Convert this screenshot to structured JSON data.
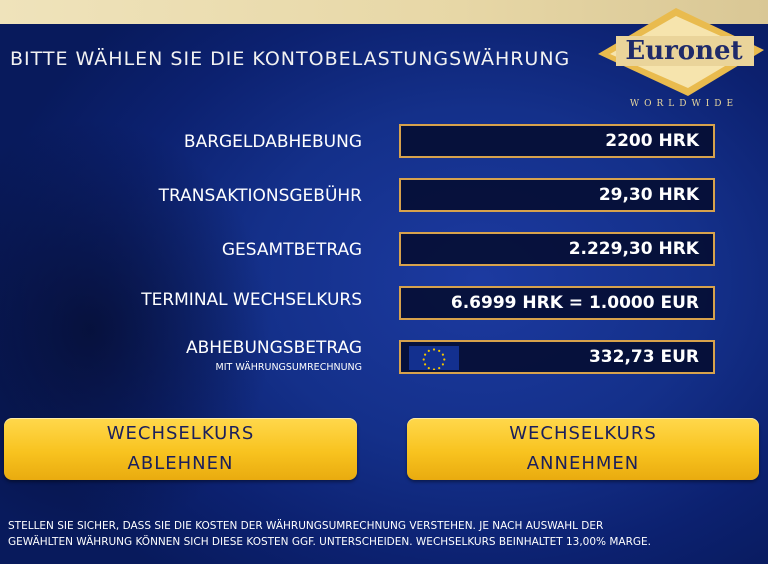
{
  "screen": {
    "title": "BITTE WÄHLEN SIE DIE KONTOBELASTUNGSWÄHRUNG",
    "brand": {
      "name": "Euronet",
      "tagline": "WORLDWIDE"
    },
    "rows": [
      {
        "label": "BARGELDABHEBUNG",
        "value": "2200 HRK"
      },
      {
        "label": "TRANSAKTIONSGEBÜHR",
        "value": "29,30 HRK"
      },
      {
        "label": "GESAMTBETRAG",
        "value": "2.229,30 HRK"
      },
      {
        "label": "TERMINAL WECHSELKURS",
        "value": "6.6999 HRK = 1.0000 EUR"
      },
      {
        "label": "ABHEBUNGSBETRAG",
        "sublabel": "MIT WÄHRUNGSUMRECHNUNG",
        "value": "332,73 EUR",
        "icon": "eu-flag-icon"
      }
    ],
    "buttons": {
      "decline": {
        "line1": "WECHSELKURS",
        "line2": "ABLEHNEN"
      },
      "accept": {
        "line1": "WECHSELKURS",
        "line2": "ANNEHMEN"
      }
    },
    "footer": {
      "line1": "STELLEN SIE SICHER, DASS SIE DIE KOSTEN DER WÄHRUNGSUMRECHNUNG VERSTEHEN. JE NACH AUSWAHL DER",
      "line2": "GEWÄHLTEN WÄHRUNG KÖNNEN SICH DIESE KOSTEN GGF. UNTERSCHEIDEN. WECHSELKURS BEINHALTET 13,00% MARGE."
    },
    "colors": {
      "background": "#14308a",
      "field_border": "#d7a24c",
      "button": "#f8c31f",
      "button_text": "#1a1f5c",
      "brand_gold": "#e9bb4e"
    }
  }
}
